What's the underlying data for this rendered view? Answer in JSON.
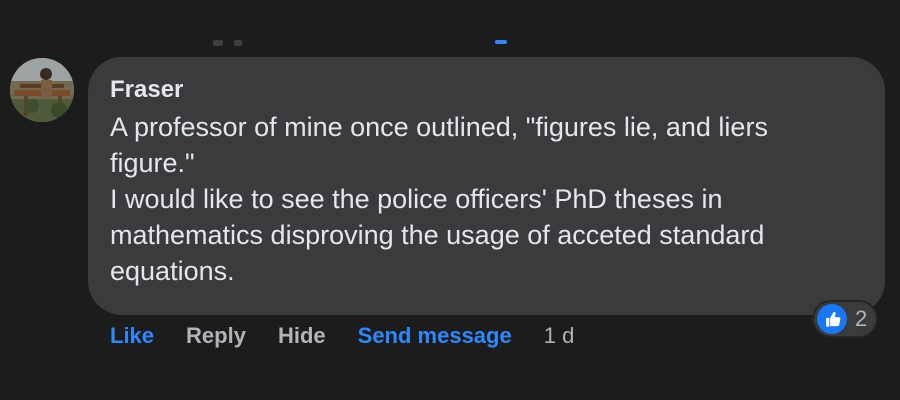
{
  "comment": {
    "author": "Fraser",
    "text_lines": [
      "A professor of mine once outlined, \"figures lie, and liers",
      "figure.\"",
      "I would like to see the police officers' PhD theses in",
      "mathematics disproving the usage of acceted standard",
      "equations."
    ],
    "reaction_icon": "thumbs-up-icon",
    "reaction_count": "2"
  },
  "actions": {
    "like_label": "Like",
    "reply_label": "Reply",
    "hide_label": "Hide",
    "send_message_label": "Send message",
    "timestamp": "1 d"
  },
  "colors": {
    "background": "#1c1c1d",
    "bubble": "#3a3b3c",
    "text": "#e4e6eb",
    "muted_text": "#b0b3b8",
    "blue": "#2d88ff"
  }
}
